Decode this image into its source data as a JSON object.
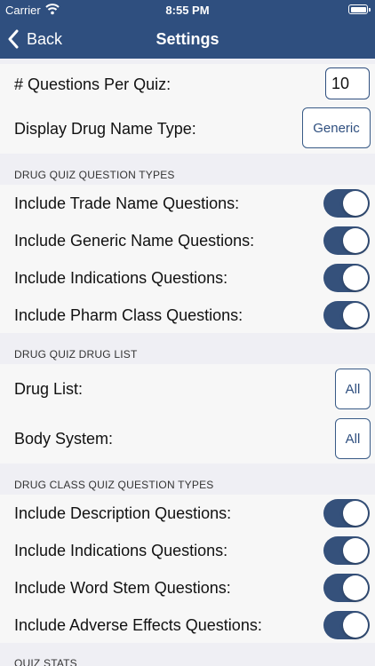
{
  "status_bar": {
    "carrier": "Carrier",
    "time": "8:55 PM"
  },
  "nav": {
    "back_label": "Back",
    "title": "Settings"
  },
  "general": {
    "questions_per_quiz_label": "# Questions Per Quiz:",
    "questions_per_quiz_value": "10",
    "display_name_type_label": "Display Drug Name Type:",
    "display_name_type_value": "Generic"
  },
  "drug_quiz_question_types": {
    "header": "DRUG QUIZ QUESTION TYPES",
    "items": [
      {
        "label": "Include Trade Name Questions:",
        "on": true
      },
      {
        "label": "Include Generic Name Questions:",
        "on": true
      },
      {
        "label": "Include Indications Questions:",
        "on": true
      },
      {
        "label": "Include Pharm Class Questions:",
        "on": true
      }
    ]
  },
  "drug_quiz_drug_list": {
    "header": "DRUG QUIZ DRUG LIST",
    "drug_list_label": "Drug List:",
    "drug_list_value": "All",
    "body_system_label": "Body System:",
    "body_system_value": "All"
  },
  "drug_class_quiz_question_types": {
    "header": "DRUG CLASS QUIZ QUESTION TYPES",
    "items": [
      {
        "label": "Include Description Questions:",
        "on": true
      },
      {
        "label": "Include Indications Questions:",
        "on": true
      },
      {
        "label": "Include Word Stem Questions:",
        "on": true
      },
      {
        "label": "Include Adverse Effects Questions:",
        "on": true
      }
    ]
  },
  "quiz_stats": {
    "header": "QUIZ STATS"
  },
  "colors": {
    "nav_bar": "#2f4f7f",
    "toggle_on": "#35517b",
    "group_bg": "#f7f7f7",
    "page_bg": "#efeff4"
  }
}
